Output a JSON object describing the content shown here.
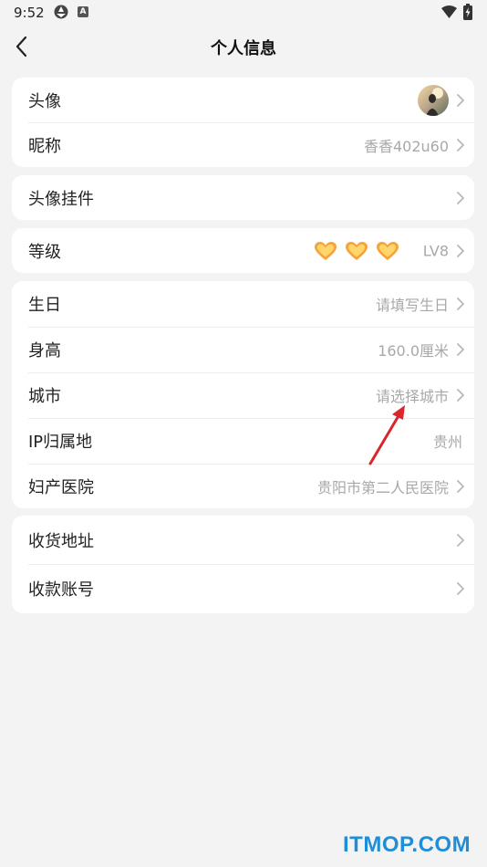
{
  "status_bar": {
    "time": "9:52",
    "app_badge": "A"
  },
  "nav": {
    "title": "个人信息"
  },
  "card1": {
    "avatar_label": "头像",
    "nickname_label": "昵称",
    "nickname_value": "香香402u60"
  },
  "card2": {
    "pendant_label": "头像挂件"
  },
  "card3": {
    "level_label": "等级",
    "level_value": "LV8"
  },
  "card4": {
    "birthday_label": "生日",
    "birthday_value": "请填写生日",
    "height_label": "身高",
    "height_value": "160.0厘米",
    "city_label": "城市",
    "city_value": "请选择城市",
    "ip_label": "IP归属地",
    "ip_value": "贵州",
    "hospital_label": "妇产医院",
    "hospital_value": "贵阳市第二人民医院"
  },
  "card5": {
    "address_label": "收货地址",
    "account_label": "收款账号"
  },
  "colors": {
    "background": "#f3f3f3",
    "card": "#ffffff",
    "hint": "#a8a8a8",
    "annotation_arrow": "#d9252b",
    "watermark": "#1f8ed6"
  },
  "watermark": "ITMOP.COM"
}
